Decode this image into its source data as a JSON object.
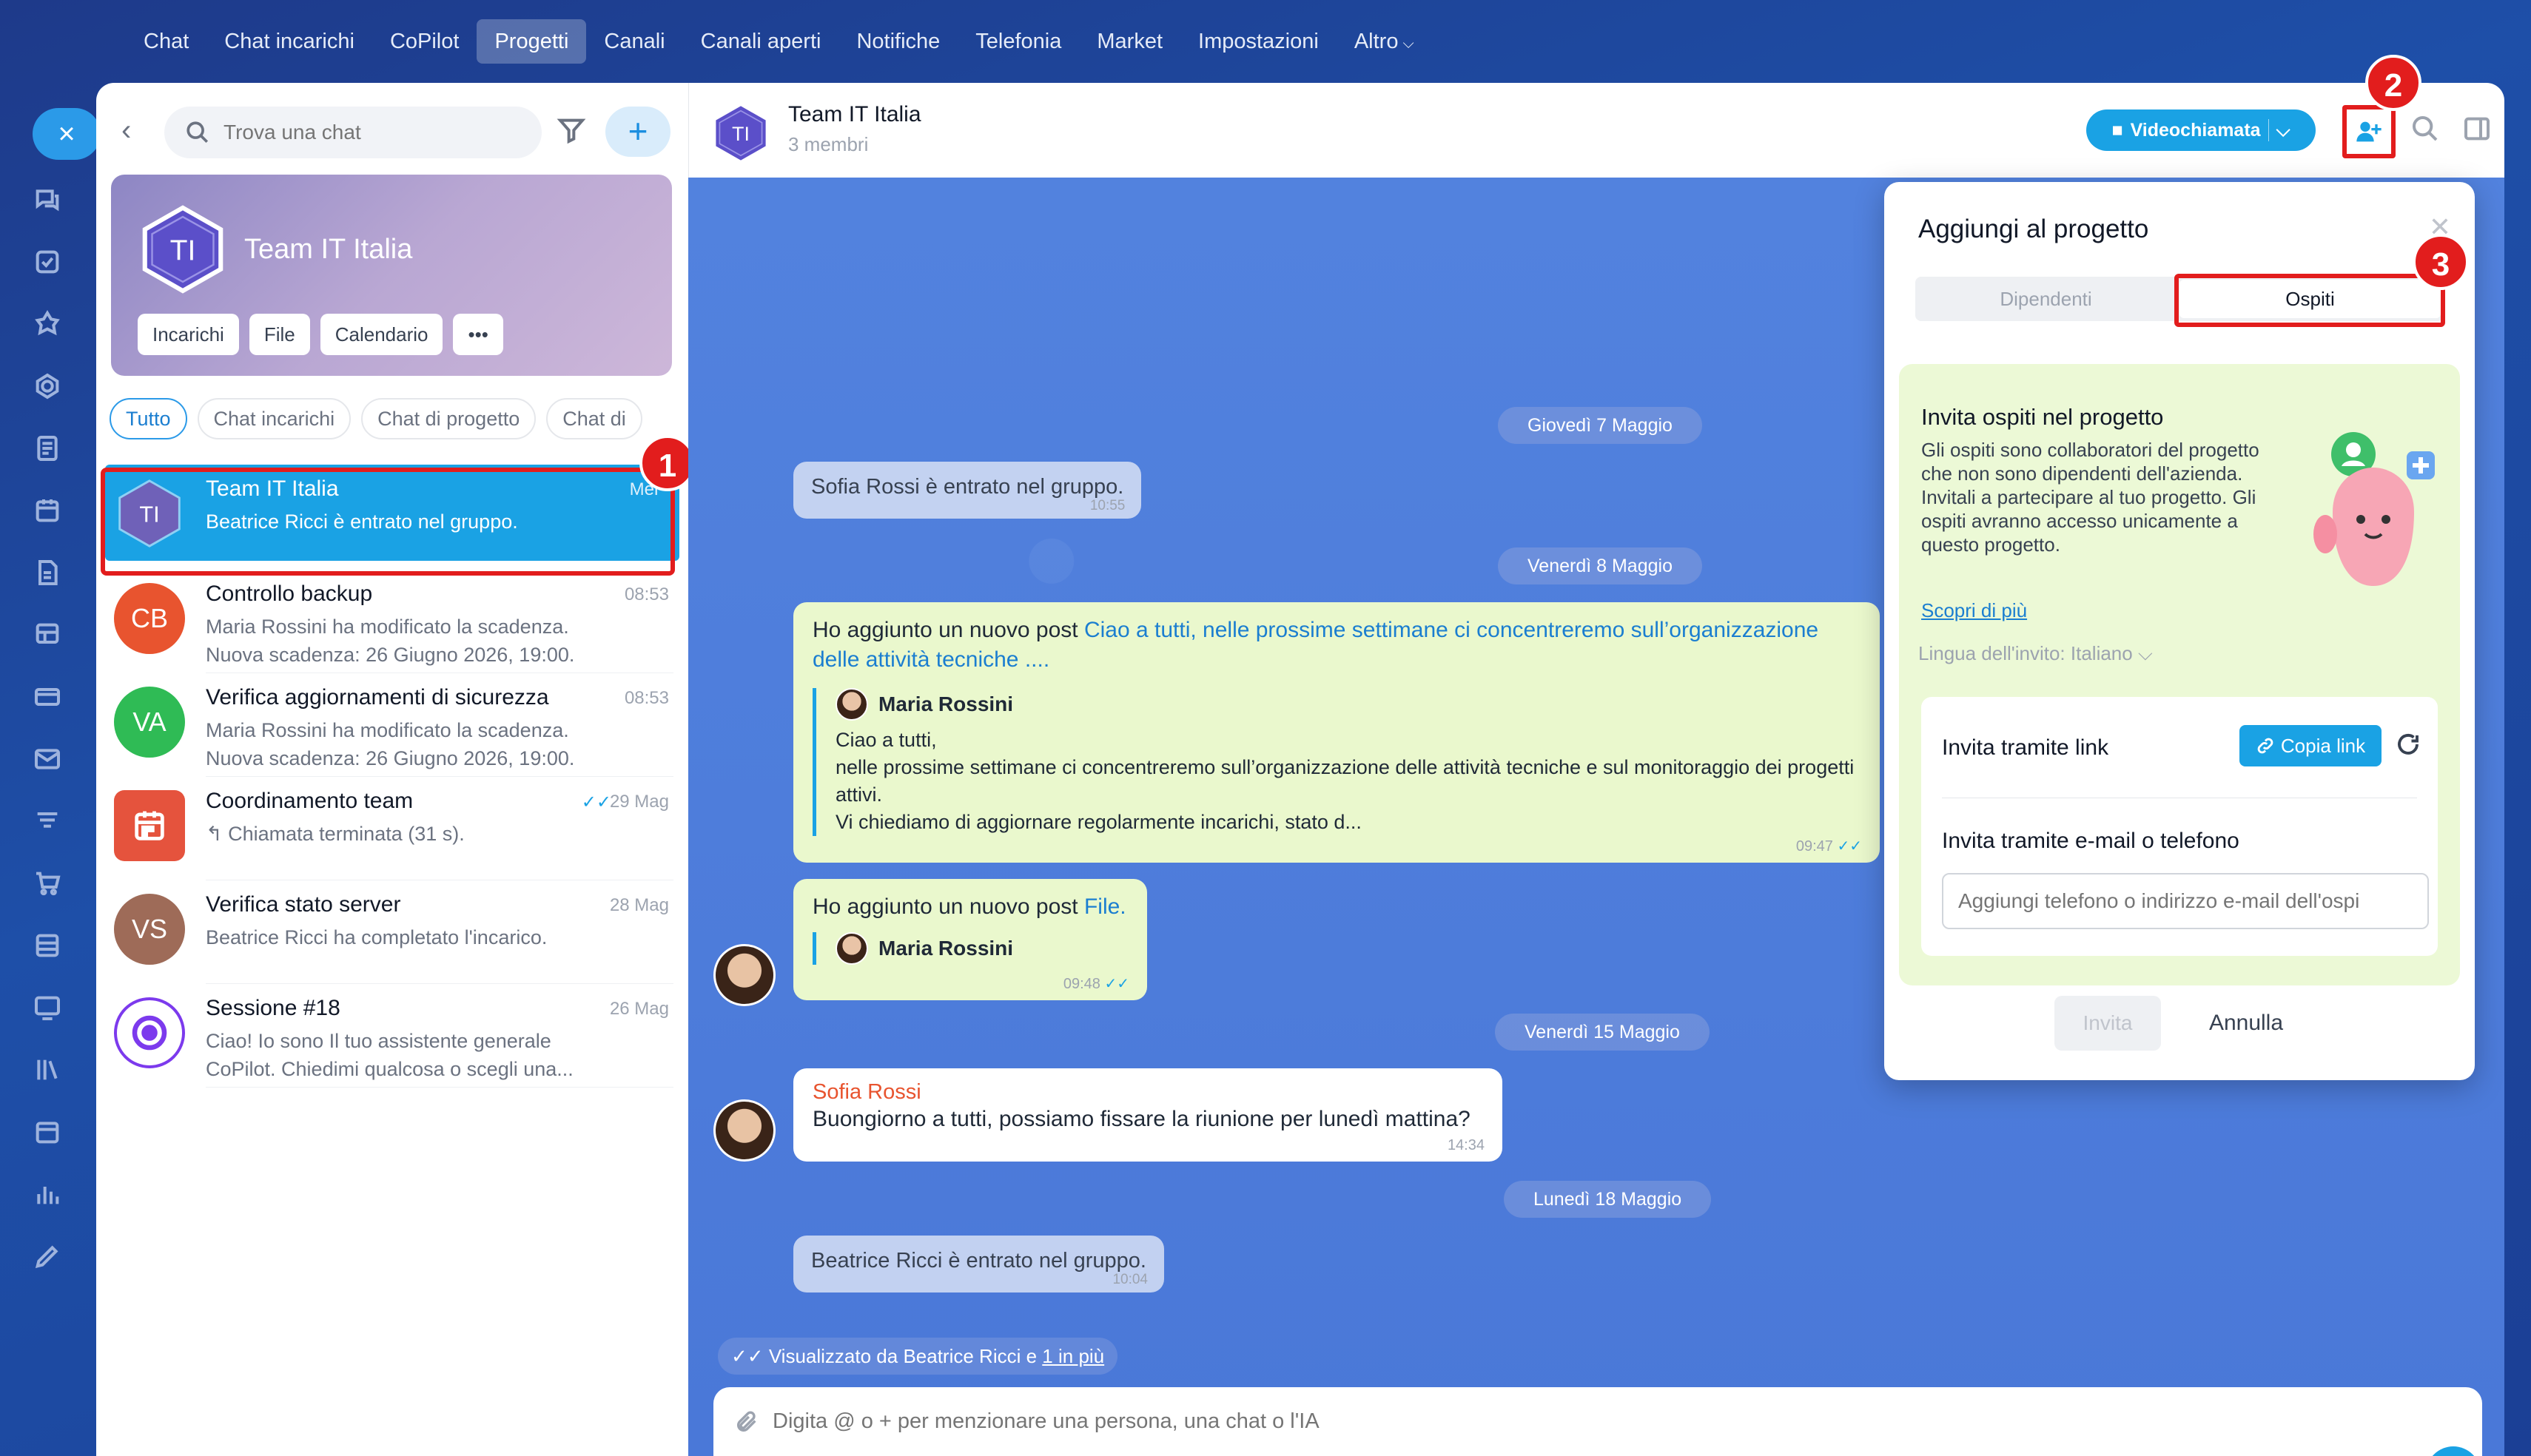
{
  "topnav": {
    "items": [
      "Chat",
      "Chat incarichi",
      "CoPilot",
      "Progetti",
      "Canali",
      "Canali aperti",
      "Notifiche",
      "Telefonia",
      "Market",
      "Impostazioni",
      "Altro"
    ],
    "active_index": 3
  },
  "rail": {
    "close_symbol": "×",
    "icons": [
      "chat-icon",
      "task-icon",
      "copilot-icon",
      "project-icon",
      "document-icon",
      "calendar-icon",
      "file-icon",
      "board-icon",
      "card-icon",
      "mail-icon",
      "filter-icon",
      "cart-icon",
      "storage-icon",
      "screen-icon",
      "library-icon",
      "schedule-icon",
      "chart-icon",
      "pen-icon"
    ]
  },
  "left": {
    "search_placeholder": "Trova una chat",
    "add_symbol": "+",
    "group": {
      "initials": "TI",
      "name": "Team IT Italia",
      "actions": [
        "Incarichi",
        "File",
        "Calendario",
        "•••"
      ]
    },
    "filters": [
      "Tutto",
      "Chat incarichi",
      "Chat di progetto",
      "Chat di"
    ],
    "chats": [
      {
        "initials": "TI",
        "name": "Team IT Italia",
        "time": "Mer",
        "preview": "Beatrice Ricci è entrato nel gruppo.",
        "color": "#6f61b8"
      },
      {
        "initials": "CB",
        "name": "Controllo backup",
        "time": "08:53",
        "preview": "Maria Rossini ha modificato la scadenza. Nuova scadenza: 26 Giugno 2026, 19:00.",
        "color": "#e8542f"
      },
      {
        "initials": "VA",
        "name": "Verifica aggiornamenti di sicurezza",
        "time": "08:53",
        "preview": "Maria Rossini ha modificato la scadenza. Nuova scadenza: 26 Giugno 2026, 19:00.",
        "color": "#2fbb55"
      },
      {
        "initials": "",
        "name": "Coordinamento team",
        "time": "29 Mag",
        "preview": "↰ Chiamata terminata (31 s).",
        "color": "#e5533d"
      },
      {
        "initials": "VS",
        "name": "Verifica stato server",
        "time": "28 Mag",
        "preview": "Beatrice Ricci ha completato l'incarico.",
        "color": "#9e6b58"
      },
      {
        "initials": "",
        "name": "Sessione #18",
        "time": "26 Mag",
        "preview": "Ciao! Io sono Il tuo assistente generale CoPilot. Chiedimi qualcosa o scegli una...",
        "color": "#7c3aed"
      }
    ]
  },
  "header": {
    "initials": "TI",
    "title": "Team IT Italia",
    "subtitle": "3 membri",
    "video_label": "Videochiamata"
  },
  "badges": [
    "1",
    "2",
    "3"
  ],
  "messages": {
    "d1": "Giovedì 7 Maggio",
    "sys1": {
      "text": "Sofia Rossi è entrato nel gruppo.",
      "time": "10:55"
    },
    "d2": "Venerdì 8 Maggio",
    "post1": {
      "prefix": "Ho aggiunto un nuovo post ",
      "link": "Ciao a tutti, nelle prossime settimane ci concentreremo sull’organizzazione delle attività tecniche ....",
      "author": "Maria Rossini",
      "body": "Ciao a tutti,\nnelle prossime settimane ci concentreremo sull’organizzazione delle attività tecniche e sul monitoraggio dei progetti attivi.\nVi chiediamo di aggiornare regolarmente incarichi, stato d...",
      "time": "09:47"
    },
    "post2": {
      "prefix": "Ho aggiunto un nuovo post ",
      "link": "File.",
      "author": "Maria Rossini",
      "time": "09:48"
    },
    "d3": "Venerdì 15 Maggio",
    "msg3": {
      "author": "Sofia Rossi",
      "text": "Buongiorno a tutti, possiamo fissare la riunione per lunedì mattina?",
      "time": "14:34"
    },
    "d4": "Lunedì 18 Maggio",
    "sys2": {
      "text": "Beatrice Ricci è entrato nel gruppo.",
      "time": "10:04"
    },
    "seen_prefix": "Visualizzato da Beatrice Ricci e ",
    "seen_link": "1 in più"
  },
  "composer": {
    "placeholder": "Digita @ o + per menzionare una persona, una chat o l'IA"
  },
  "popup": {
    "title": "Aggiungi al progetto",
    "tabs": [
      "Dipendenti",
      "Ospiti"
    ],
    "invite_title": "Invita ospiti nel progetto",
    "invite_desc": "Gli ospiti sono collaboratori del progetto che non sono dipendenti dell'azienda. Invitali a partecipare al tuo progetto. Gli ospiti avranno accesso unicamente a questo progetto.",
    "more": "Scopri di più",
    "lang_label": "Lingua dell'invito:",
    "lang_value": "Italiano",
    "link_label": "Invita tramite link",
    "copy_label": "Copia link",
    "email_label": "Invita tramite e-mail o telefono",
    "email_placeholder": "Aggiungi telefono o indirizzo e-mail dell'ospi",
    "invite_btn": "Invita",
    "cancel_btn": "Annulla"
  }
}
